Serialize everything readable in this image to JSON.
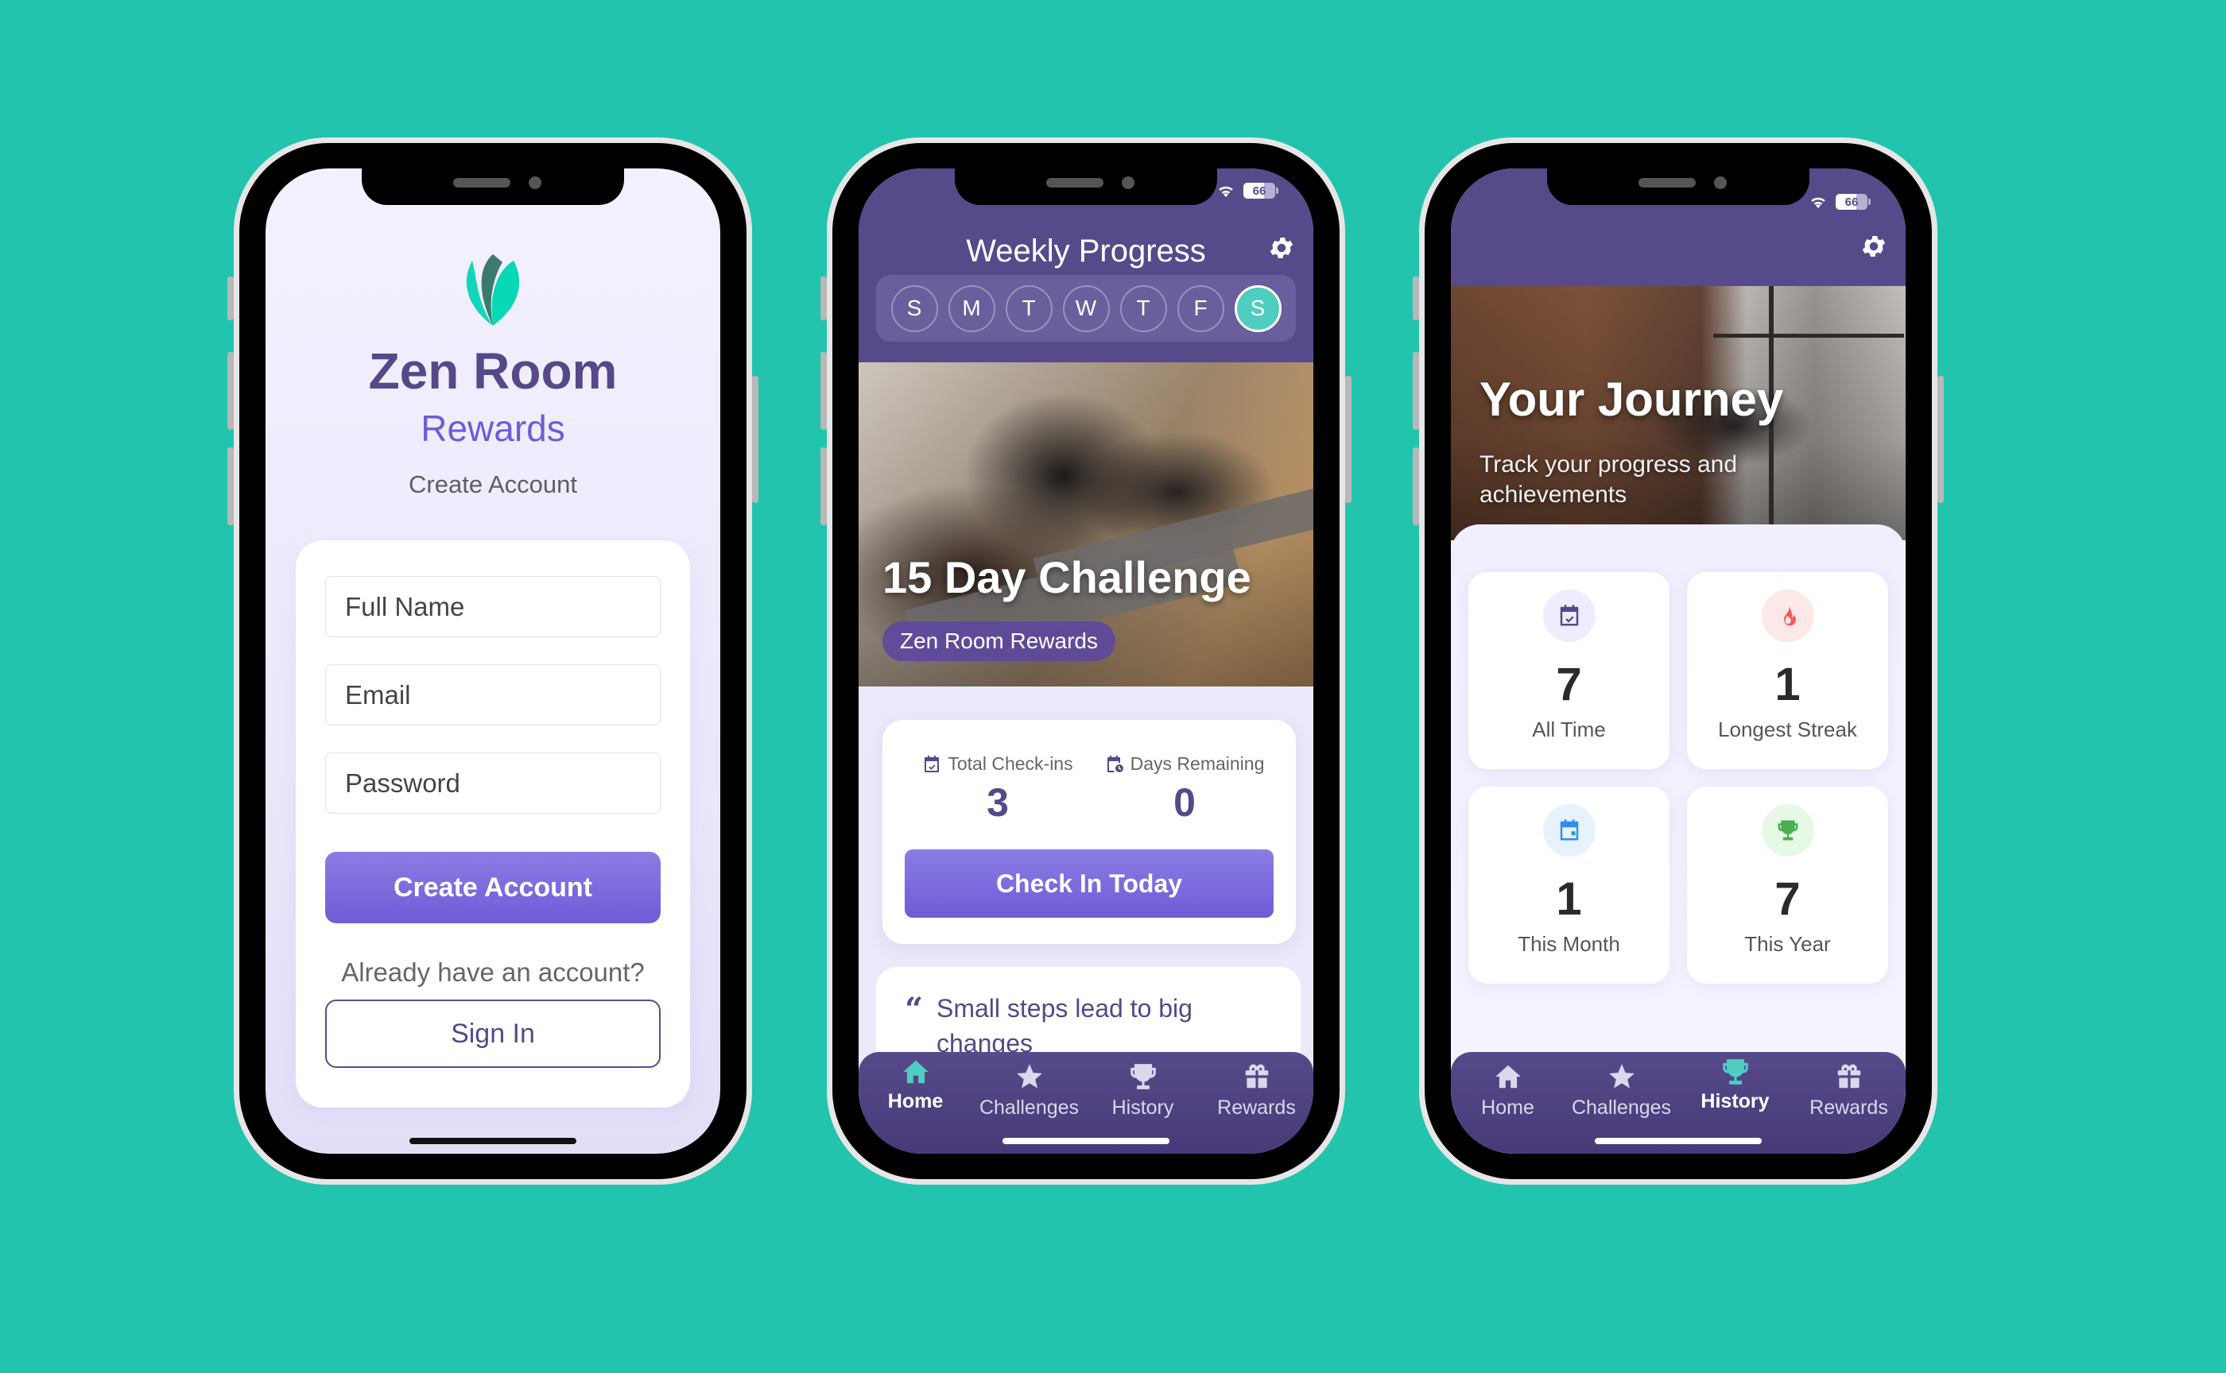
{
  "background_color": "#22c4ae",
  "colors": {
    "primary_purple": "#574a8a",
    "accent_violet": "#6f5cd9",
    "accent_teal": "#4ecdc0",
    "text_dark_purple": "#564889"
  },
  "status_bar": {
    "battery_level": 66,
    "battery_label": "66",
    "wifi_icon": "wifi-icon"
  },
  "signup": {
    "logo_icon": "lotus-leaf-icon",
    "brand_title": "Zen Room",
    "brand_subtitle": "Rewards",
    "heading": "Create Account",
    "fields": {
      "full_name": {
        "placeholder": "Full Name",
        "value": ""
      },
      "email": {
        "placeholder": "Email",
        "value": ""
      },
      "password": {
        "placeholder": "Password",
        "value": ""
      }
    },
    "create_button": "Create Account",
    "already_text": "Already have an account?",
    "signin_button": "Sign In"
  },
  "home": {
    "title": "Weekly Progress",
    "settings_icon": "gear-icon",
    "week_days": [
      {
        "label": "S",
        "active": false
      },
      {
        "label": "M",
        "active": false
      },
      {
        "label": "T",
        "active": false
      },
      {
        "label": "W",
        "active": false
      },
      {
        "label": "T",
        "active": false
      },
      {
        "label": "F",
        "active": false
      },
      {
        "label": "S",
        "active": true
      }
    ],
    "hero": {
      "title": "15 Day Challenge",
      "badge": "Zen Room Rewards"
    },
    "stats": {
      "total_checkins_label": "Total Check-ins",
      "total_checkins_value": "3",
      "days_remaining_label": "Days Remaining",
      "days_remaining_value": "0"
    },
    "checkin_button": "Check In Today",
    "quote": "Small steps lead to big changes"
  },
  "history": {
    "settings_icon": "gear-icon",
    "hero": {
      "title": "Your Journey",
      "subtitle": "Track your progress and achievements"
    },
    "metrics": [
      {
        "value": "7",
        "label": "All Time",
        "icon": "calendar-check-icon",
        "icon_color": "#564889",
        "icon_bg": "#efecfd"
      },
      {
        "value": "1",
        "label": "Longest Streak",
        "icon": "fire-icon",
        "icon_color": "#f25c5c",
        "icon_bg": "#fde8e8"
      },
      {
        "value": "1",
        "label": "This Month",
        "icon": "calendar-day-icon",
        "icon_color": "#2f8ff0",
        "icon_bg": "#e6f2fd"
      },
      {
        "value": "7",
        "label": "This Year",
        "icon": "trophy-icon",
        "icon_color": "#4caf50",
        "icon_bg": "#e6f9e6"
      }
    ]
  },
  "tabbar": {
    "tabs": [
      {
        "label": "Home",
        "icon": "home-icon"
      },
      {
        "label": "Challenges",
        "icon": "star-icon"
      },
      {
        "label": "History",
        "icon": "trophy-icon"
      },
      {
        "label": "Rewards",
        "icon": "gift-icon"
      }
    ],
    "active_home_screen": "Home",
    "active_history_screen": "History"
  }
}
